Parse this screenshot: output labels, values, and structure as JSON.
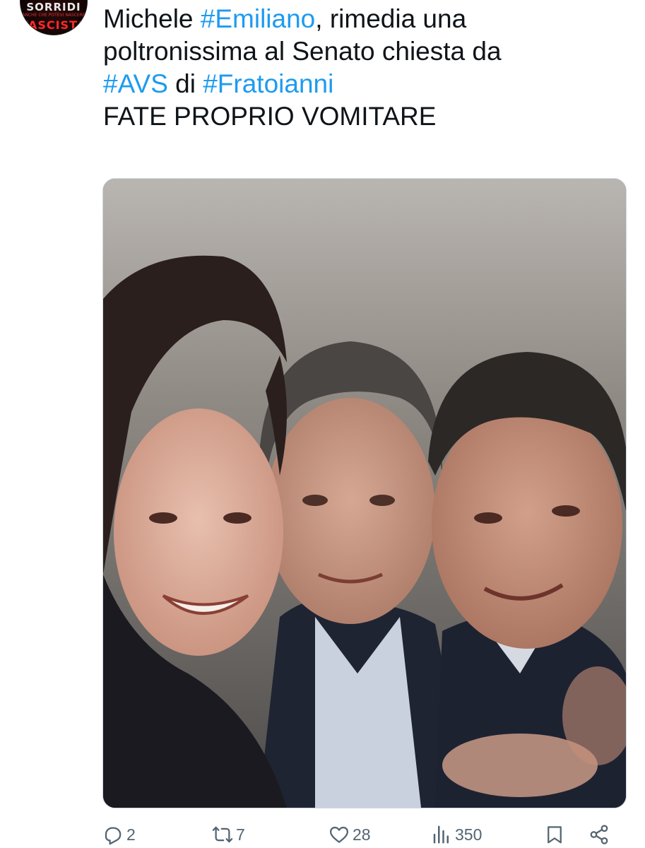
{
  "author": {
    "avatar_text_top": "SORRIDI",
    "avatar_text_mid": "ANCHE CHE POTEVI NASCERE",
    "avatar_text_bottom": "FASCISTA"
  },
  "tweet": {
    "line1_pre": "Michele ",
    "line1_hashtag": "#Emiliano",
    "line1_post": ", rimedia una",
    "line2": "poltronissima al Senato chiesta da",
    "line3_hashtag1": "#AVS",
    "line3_mid": " di ",
    "line3_hashtag2": "#Fratoianni",
    "line4": "FATE PROPRIO VOMITARE"
  },
  "actions": {
    "replies": "2",
    "reposts": "7",
    "likes": "28",
    "views": "350"
  },
  "icons": {
    "reply": "reply-icon",
    "repost": "repost-icon",
    "like": "heart-icon",
    "views": "views-icon",
    "bookmark": "bookmark-icon",
    "share": "share-icon"
  },
  "colors": {
    "hashtag": "#1d9bf0",
    "text": "#0f1419",
    "muted": "#536471"
  }
}
